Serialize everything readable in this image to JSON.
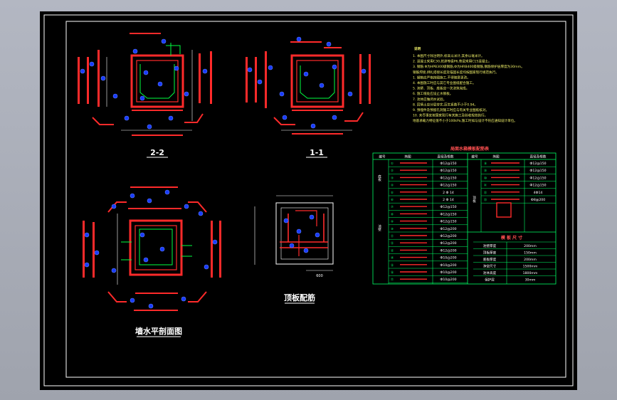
{
  "drawing": {
    "section_2_2_label": "2-2",
    "section_1_1_label": "1-1",
    "plan_label": "墙水平剖面图",
    "top_slab_label": "顶板配筋",
    "top_slab_dim": "600"
  },
  "notes": {
    "heading": "说明",
    "lines": [
      "1. 本图尺寸除注明外,标高以米计,其余以毫米计。",
      "2. 混凝土采用C30,抗渗等级P6,垫层采用C15混凝土。",
      "3. 钢筋:Φ为HPB300级钢筋,Ф为HRB400级钢筋,钢筋保护层厚度为30mm。",
      "   钢筋焊接,绑扎搭接长度及锚固长度均按国家现行规范执行。",
      "   1. 钢筋应严格按图施工,不得随意更改。",
      "4. 本图施工时应与其它专业图纸配合施工。",
      "5. 池壁、顶板、底板应一次浇筑完成。",
      "6. 施工缝处应设止水钢板。",
      "7. 池体应做闭水试验。",
      "8. 回填土应分层夯实,压实系数不小于0.94。",
      "9. 预埋件及预留孔洞施工时应与有关专业图纸核对。",
      "10. 未尽事宜按国家现行有关施工及验收规范执行。",
      "   地基承载力特征值不小于100kPa,施工时如与设计不符应通知设计单位。"
    ]
  },
  "table": {
    "title": "局面水箱模板配筋表",
    "col_headers": [
      "编号",
      "简图",
      "直径及根数",
      "编号",
      "简图",
      "直径及根数"
    ],
    "group_labels": [
      "底板",
      "池壁",
      "顶板"
    ],
    "left_rows": [
      {
        "no": "①",
        "spec": "Ф12@150"
      },
      {
        "no": "②",
        "spec": "Ф12@150"
      },
      {
        "no": "③",
        "spec": "Ф12@150"
      },
      {
        "no": "④",
        "spec": "Ф12@150"
      },
      {
        "no": "⑤",
        "spec": "2 Ф 14"
      },
      {
        "no": "⑥",
        "spec": "2 Ф 14"
      },
      {
        "no": "⑦",
        "spec": "Ф12@150"
      },
      {
        "no": "⑧",
        "spec": "Ф12@150"
      },
      {
        "no": "⑨",
        "spec": "Ф12@150"
      },
      {
        "no": "⑩",
        "spec": "Ф12@200"
      },
      {
        "no": "⑪",
        "spec": "Ф12@200"
      },
      {
        "no": "⑫",
        "spec": "Ф12@200"
      },
      {
        "no": "⑬",
        "spec": "Ф12@200"
      },
      {
        "no": "⑭",
        "spec": "Ф10@200"
      },
      {
        "no": "⑮",
        "spec": "Ф10@200"
      },
      {
        "no": "⑯",
        "spec": "Ф10@200"
      },
      {
        "no": "⑰",
        "spec": "Ф10@200"
      }
    ],
    "right_rows": [
      {
        "no": "⑱",
        "spec": "Ф12@150"
      },
      {
        "no": "⑲",
        "spec": "Ф12@150"
      },
      {
        "no": "⑳",
        "spec": "Ф12@150"
      },
      {
        "no": "㉑",
        "spec": "Ф12@150"
      },
      {
        "no": "㉒",
        "spec": "4Ф14"
      },
      {
        "no": "㉓",
        "spec": "Ф8@200"
      }
    ],
    "size_title": "模 板 尺 寸",
    "size_rows": [
      {
        "label": "池壁厚度",
        "value": "200mm"
      },
      {
        "label": "顶板厚度",
        "value": "150mm"
      },
      {
        "label": "底板厚度",
        "value": "200mm"
      },
      {
        "label": "净空尺寸",
        "value": "1500mm"
      },
      {
        "label": "池体高度",
        "value": "1800mm"
      },
      {
        "label": "保护层",
        "value": "30mm"
      }
    ]
  }
}
